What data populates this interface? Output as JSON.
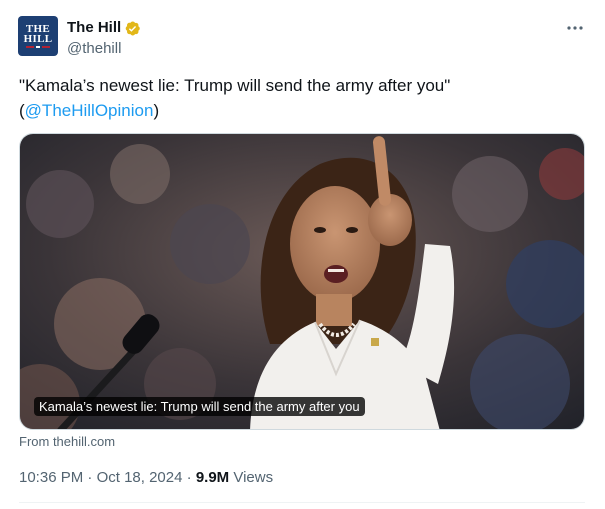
{
  "account": {
    "display_name": "The Hill",
    "handle": "@thehill",
    "avatar_line1": "THE",
    "avatar_line2": "HILL",
    "verified": true,
    "verified_color": "#e2b719"
  },
  "tweet": {
    "text_before": "\"Kamala’s newest lie: Trump will send the army after you\" (",
    "mention": "@TheHillOpinion",
    "text_after": ")"
  },
  "media": {
    "caption": "Kamala’s newest lie: Trump will send the army after you",
    "source": "From thehill.com"
  },
  "meta": {
    "time": "10:36 PM",
    "sep1": " · ",
    "date": "Oct 18, 2024",
    "sep2": " · ",
    "views_count": "9.9M",
    "views_label": " Views"
  },
  "colors": {
    "link": "#1d9bf0",
    "secondary_text": "#536471",
    "avatar_bg": "#1d3f73"
  },
  "icons": {
    "more": "more-horizontal-icon",
    "verified": "verified-badge-icon"
  }
}
